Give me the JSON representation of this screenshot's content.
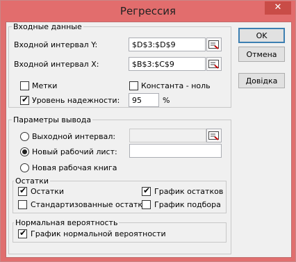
{
  "window": {
    "title": "Регрессия",
    "close_glyph": "✕"
  },
  "input": {
    "group_label": "Входные данные",
    "y_range_label": "Входной интервал Y:",
    "y_range_value": "$D$3:$D$9",
    "x_range_label": "Входной интервал X:",
    "x_range_value": "$B$3:$C$9",
    "labels_label": "Метки",
    "labels_checked": false,
    "constant_zero_label": "Константа - ноль",
    "constant_zero_checked": false,
    "confidence_label": "Уровень надежности:",
    "confidence_checked": true,
    "confidence_value": "95",
    "confidence_unit": "%"
  },
  "output": {
    "group_label": "Параметры вывода",
    "output_range_label": "Выходной интервал:",
    "output_range_value": "",
    "new_sheet_label": "Новый рабочий лист:",
    "new_sheet_value": "",
    "new_book_label": "Новая рабочая книга",
    "selected": "new_sheet"
  },
  "residuals": {
    "group_label": "Остатки",
    "residuals_label": "Остатки",
    "residuals_checked": true,
    "residual_plots_label": "График остатков",
    "residual_plots_checked": true,
    "standardized_label": "Стандартизованные остатки",
    "standardized_checked": false,
    "line_fit_label": "График подбора",
    "line_fit_checked": false
  },
  "normal_probability": {
    "group_label": "Нормальная вероятность",
    "plots_label": "График нормальной вероятности",
    "plots_checked": true
  },
  "buttons": {
    "ok": "OK",
    "cancel": "Отмена",
    "help": "Довідка"
  },
  "check_glyph": "✔",
  "colors": {
    "title_bar": "#e26d6d",
    "close_button": "#c94c47",
    "default_button_border": "#3c7fb1",
    "dialog_bg": "#f0f0f0"
  }
}
